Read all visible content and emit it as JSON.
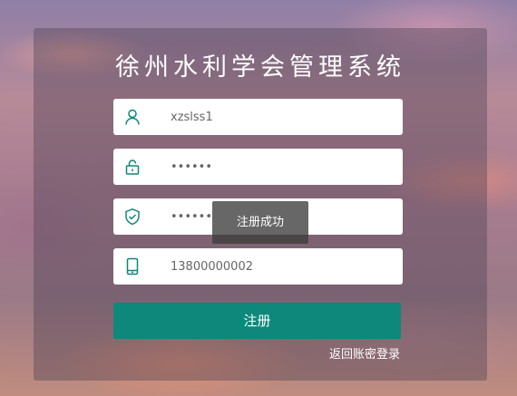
{
  "title": "徐州水利学会管理系统",
  "fields": {
    "username": {
      "value": "xzslss1",
      "icon": "user-icon"
    },
    "password": {
      "value": "••••••",
      "icon": "lock-icon"
    },
    "confirm_password": {
      "value": "••••••",
      "icon": "shield-check-icon"
    },
    "phone": {
      "value": "13800000002",
      "icon": "mobile-phone-icon"
    }
  },
  "register_button": "注册",
  "back_to_login_link": "返回账密登录",
  "toast": "注册成功",
  "colors": {
    "accent": "#0e887a",
    "icon": "#0e887a",
    "text": "#666666"
  }
}
